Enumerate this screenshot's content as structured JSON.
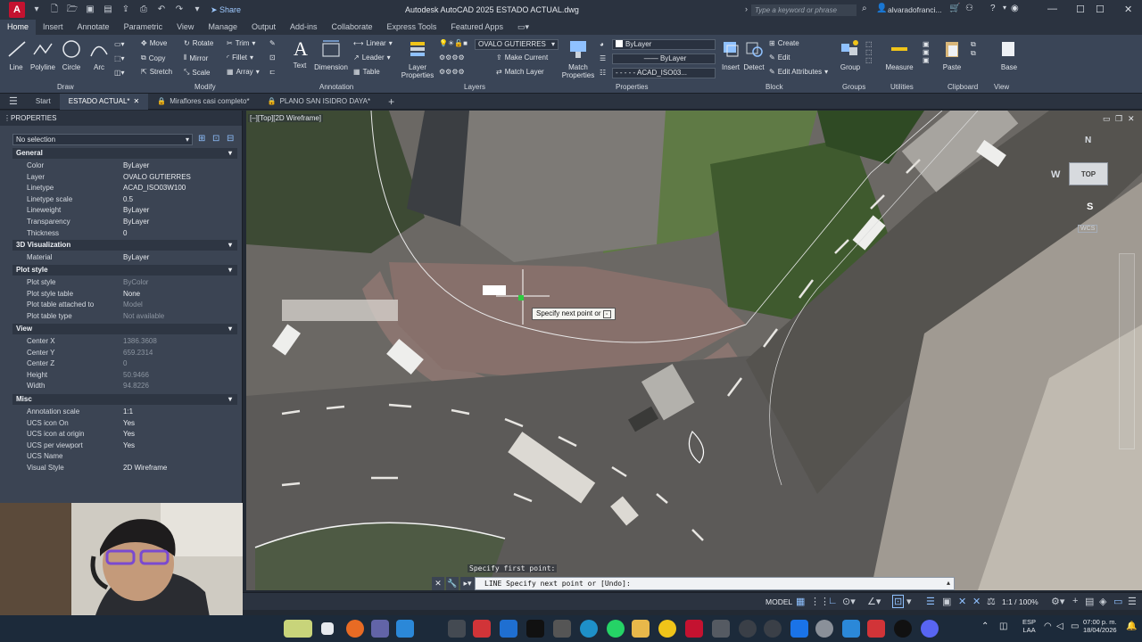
{
  "titlebar": {
    "logo": "A",
    "share": "Share",
    "title": "Autodesk AutoCAD 2025   ESTADO ACTUAL.dwg",
    "search_placeholder": "Type a keyword or phrase",
    "user": "alvaradofranci..."
  },
  "ribbon_tabs": [
    "Home",
    "Insert",
    "Annotate",
    "Parametric",
    "View",
    "Manage",
    "Output",
    "Add-ins",
    "Collaborate",
    "Express Tools",
    "Featured Apps"
  ],
  "ribbon": {
    "draw": {
      "label": "Draw",
      "line": "Line",
      "polyline": "Polyline",
      "circle": "Circle",
      "arc": "Arc"
    },
    "modify": {
      "label": "Modify",
      "move": "Move",
      "rotate": "Rotate",
      "trim": "Trim",
      "copy": "Copy",
      "mirror": "Mirror",
      "fillet": "Fillet",
      "stretch": "Stretch",
      "scale": "Scale",
      "array": "Array"
    },
    "annotation": {
      "label": "Annotation",
      "text": "Text",
      "dimension": "Dimension",
      "linear": "Linear",
      "leader": "Leader",
      "table": "Table"
    },
    "layers": {
      "label": "Layers",
      "layer_properties": "Layer Properties",
      "current_layer": "OVALO GUTIERRES",
      "make_current": "Make Current",
      "match_layer": "Match Layer"
    },
    "properties": {
      "label": "Properties",
      "match": "Match Properties",
      "color": "ByLayer",
      "lineweight": "ByLayer",
      "linetype": "ACAD_ISO03..."
    },
    "block": {
      "label": "Block",
      "insert": "Insert",
      "detect": "Detect",
      "create": "Create",
      "edit": "Edit",
      "edit_attributes": "Edit Attributes"
    },
    "groups": {
      "label": "Groups",
      "group": "Group"
    },
    "utilities": {
      "label": "Utilities",
      "measure": "Measure"
    },
    "clipboard": {
      "label": "Clipboard",
      "paste": "Paste"
    },
    "view": {
      "label": "View",
      "base": "Base"
    }
  },
  "file_tabs": {
    "start": "Start",
    "tabs": [
      "ESTADO ACTUAL*",
      "Miraflores casi completo*",
      "PLANO SAN ISIDRO DAYA*"
    ]
  },
  "properties": {
    "title": "PROPERTIES",
    "selection": "No selection",
    "sections": {
      "general": "General",
      "viz": "3D Visualization",
      "plot": "Plot style",
      "view": "View",
      "misc": "Misc"
    },
    "general": [
      {
        "k": "Color",
        "v": "ByLayer"
      },
      {
        "k": "Layer",
        "v": "OVALO GUTIERRES"
      },
      {
        "k": "Linetype",
        "v": "ACAD_ISO03W100"
      },
      {
        "k": "Linetype scale",
        "v": "0.5"
      },
      {
        "k": "Lineweight",
        "v": "ByLayer"
      },
      {
        "k": "Transparency",
        "v": "ByLayer"
      },
      {
        "k": "Thickness",
        "v": "0"
      }
    ],
    "viz": [
      {
        "k": "Material",
        "v": "ByLayer"
      }
    ],
    "plot": [
      {
        "k": "Plot style",
        "v": "ByColor"
      },
      {
        "k": "Plot style table",
        "v": "None"
      },
      {
        "k": "Plot table attached to",
        "v": "Model"
      },
      {
        "k": "Plot table type",
        "v": "Not available"
      }
    ],
    "view": [
      {
        "k": "Center X",
        "v": "1386.3608"
      },
      {
        "k": "Center Y",
        "v": "659.2314"
      },
      {
        "k": "Center Z",
        "v": "0"
      },
      {
        "k": "Height",
        "v": "50.9466"
      },
      {
        "k": "Width",
        "v": "94.8226"
      }
    ],
    "misc": [
      {
        "k": "Annotation scale",
        "v": "1:1"
      },
      {
        "k": "UCS icon On",
        "v": "Yes"
      },
      {
        "k": "UCS icon at origin",
        "v": "Yes"
      },
      {
        "k": "UCS per viewport",
        "v": "Yes"
      },
      {
        "k": "UCS Name",
        "v": ""
      },
      {
        "k": "Visual Style",
        "v": "2D Wireframe"
      }
    ]
  },
  "viewport": {
    "label": "[–][Top][2D Wireframe]",
    "tooltip": "Specify next point or",
    "viewcube_top": "TOP",
    "viewcube_n": "N",
    "viewcube_w": "W",
    "viewcube_s": "S",
    "wcs": "WCS"
  },
  "command": {
    "history": "Specify first point:",
    "prompt": "LINE Specify next point or [Undo]:"
  },
  "statusbar": {
    "model": "MODEL",
    "scale": "1:1 / 100%"
  },
  "taskbar": {
    "lang1": "ESP",
    "lang2": "LAA",
    "time": "07:00 p. m.",
    "date": "18/04/2026"
  }
}
